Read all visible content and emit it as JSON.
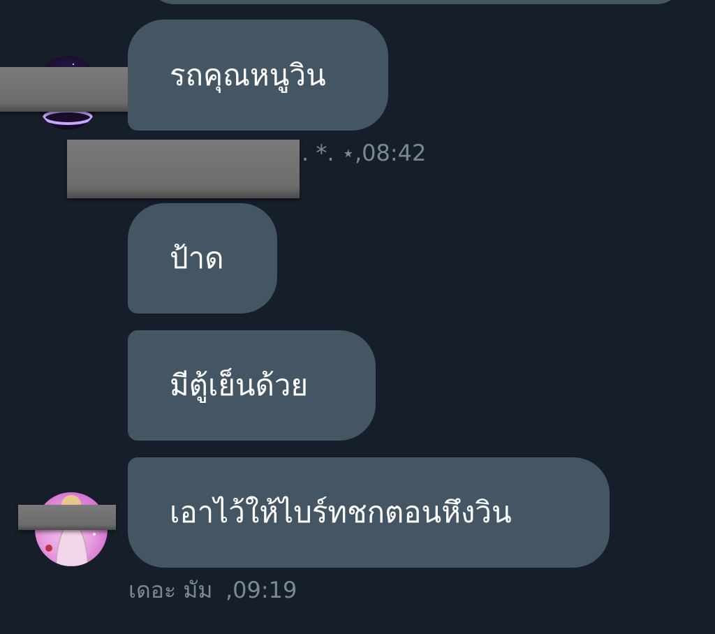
{
  "messages": [
    {
      "text": "รถคุณหนูวิน"
    },
    {
      "text": "ป้าด"
    },
    {
      "text": "มีตู้เย็นด้วย"
    },
    {
      "text": "เอาไว้ให้ไบร์ทชกตอนหึงวิน"
    }
  ],
  "meta": {
    "first_sender_tail": ". *. ⋆",
    "first_time": ",08:42",
    "second_sender": "เดอะ มัม",
    "second_time": ",09:19"
  },
  "avatars": {
    "first": "galaxy-ring-avatar",
    "second": "pink-photo-avatar"
  },
  "colors": {
    "background": "#161f29",
    "bubble": "#445564",
    "meta_text": "#7b8896"
  }
}
